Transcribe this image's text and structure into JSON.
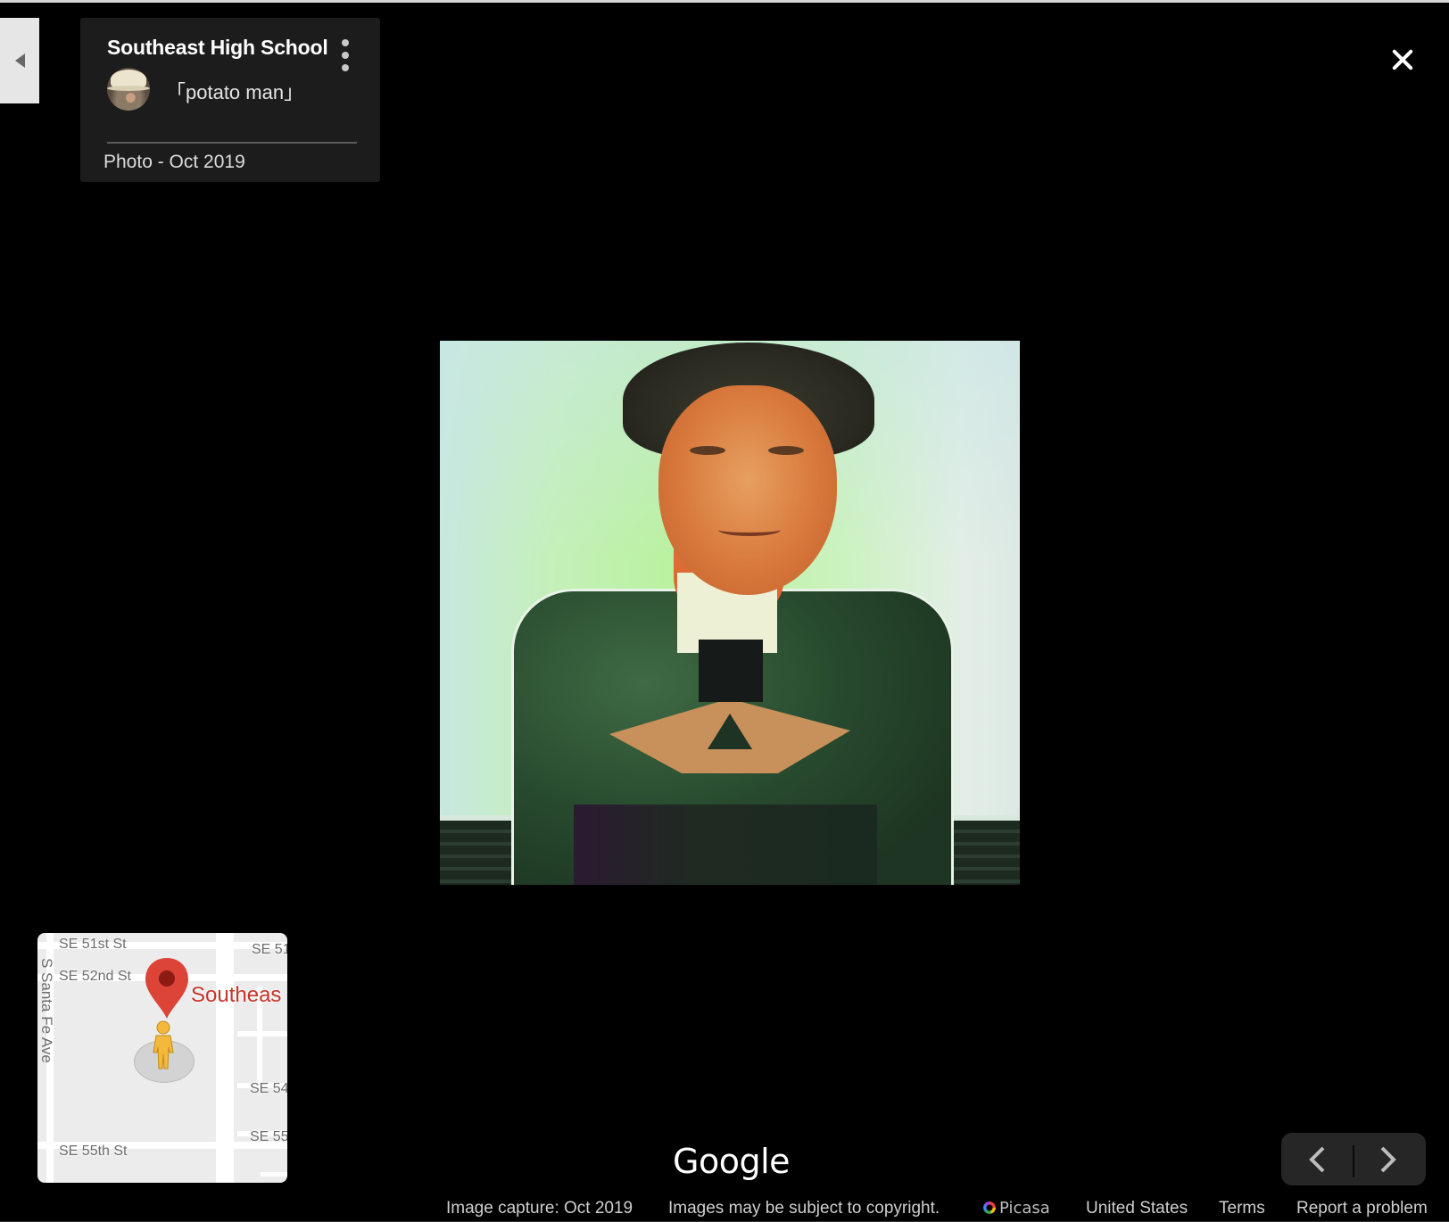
{
  "card": {
    "title": "Southeast High School",
    "author": "「potato man」",
    "meta": "Photo - Oct 2019"
  },
  "icons": {
    "collapse": "triangle-left-icon",
    "more": "more-vert-icon",
    "close": "close-icon",
    "prev": "chevron-left-icon",
    "next": "chevron-right-icon",
    "pin": "map-pin-icon",
    "pegman": "pegman-icon",
    "picasa": "picasa-logo-icon"
  },
  "minimap": {
    "streets": [
      "SE 51st St",
      "SE 52nd St",
      "SE 55th St",
      "SE 51",
      "SE 54",
      "SE 55"
    ],
    "avenue": "S Santa Fe Ave",
    "place_label": "Southeas",
    "pin_color": "#db4437"
  },
  "branding": {
    "logo": "Google"
  },
  "footer": {
    "capture": "Image capture: Oct 2019",
    "copyright": "Images may be subject to copyright.",
    "source": "Picasa",
    "country": "United States",
    "terms": "Terms",
    "report": "Report a problem"
  }
}
